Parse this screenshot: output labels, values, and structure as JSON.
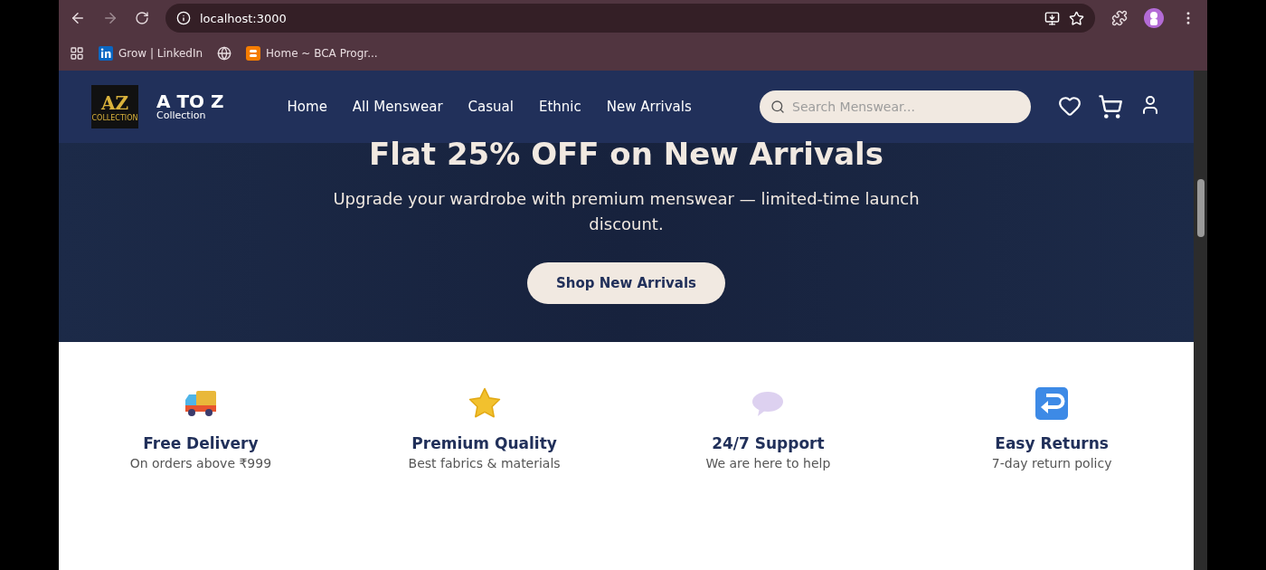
{
  "browser": {
    "url": "localhost:3000",
    "bookmarks": [
      {
        "kind": "linkedin",
        "label": "Grow | LinkedIn"
      },
      {
        "kind": "globe"
      },
      {
        "kind": "blogger",
        "label": "Home ~ BCA Progr..."
      }
    ]
  },
  "navbar": {
    "logo": {
      "letters": "AZ",
      "caption": "COLLECTION",
      "title": "A TO Z",
      "subtitle": "Collection"
    },
    "links": [
      "Home",
      "All Menswear",
      "Casual",
      "Ethnic",
      "New Arrivals"
    ],
    "search": {
      "placeholder": "Search Menswear..."
    }
  },
  "hero": {
    "heading": "Flat 25% OFF on New Arrivals",
    "text": "Upgrade your wardrobe with premium menswear — limited-time launch discount.",
    "button": "Shop New Arrivals"
  },
  "features": [
    {
      "kind": "truck",
      "title": "Free Delivery",
      "text": "On orders above ₹999"
    },
    {
      "kind": "star",
      "title": "Premium Quality",
      "text": "Best fabrics & materials"
    },
    {
      "kind": "chat",
      "title": "24/7 Support",
      "text": "We are here to help"
    },
    {
      "kind": "return",
      "title": "Easy Returns",
      "text": "7-day return policy"
    }
  ]
}
